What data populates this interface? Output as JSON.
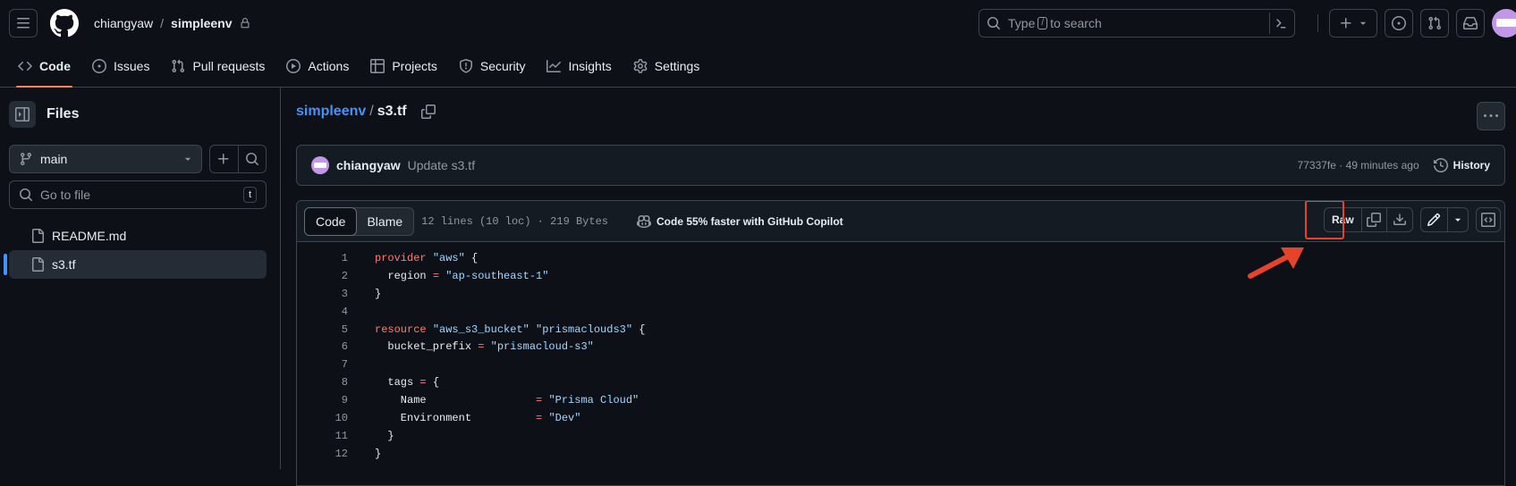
{
  "header": {
    "owner": "chiangyaw",
    "separator": "/",
    "repo": "simpleenv",
    "search_prefix": "Type",
    "search_key": "/",
    "search_suffix": "to search",
    "plus_label": "+"
  },
  "nav": {
    "tabs": [
      {
        "label": "Code",
        "icon": "code-icon"
      },
      {
        "label": "Issues",
        "icon": "issue-icon"
      },
      {
        "label": "Pull requests",
        "icon": "pull-request-icon"
      },
      {
        "label": "Actions",
        "icon": "play-icon"
      },
      {
        "label": "Projects",
        "icon": "table-icon"
      },
      {
        "label": "Security",
        "icon": "shield-icon"
      },
      {
        "label": "Insights",
        "icon": "graph-icon"
      },
      {
        "label": "Settings",
        "icon": "gear-icon"
      }
    ]
  },
  "sidebar": {
    "title": "Files",
    "branch": "main",
    "goto_placeholder": "Go to file",
    "goto_key": "t",
    "files": [
      {
        "name": "README.md",
        "selected": false
      },
      {
        "name": "s3.tf",
        "selected": true
      }
    ]
  },
  "file": {
    "repo_link": "simpleenv",
    "separator": "/",
    "name": "s3.tf"
  },
  "commit": {
    "author": "chiangyaw",
    "message": "Update s3.tf",
    "meta": "77337fe · 49 minutes ago",
    "history_label": "History"
  },
  "code": {
    "tab_code": "Code",
    "tab_blame": "Blame",
    "line_info": "12 lines (10 loc) · 219 Bytes",
    "copilot": "Code 55% faster with GitHub Copilot",
    "raw_label": "Raw",
    "lines": [
      {
        "n": "1",
        "parts": [
          [
            "kw",
            "provider"
          ],
          [
            "ident",
            " "
          ],
          [
            "str",
            "\"aws\""
          ],
          [
            "ident",
            " {"
          ]
        ]
      },
      {
        "n": "2",
        "parts": [
          [
            "ident",
            "  region "
          ],
          [
            "op",
            "="
          ],
          [
            "ident",
            " "
          ],
          [
            "str",
            "\"ap-southeast-1\""
          ]
        ]
      },
      {
        "n": "3",
        "parts": [
          [
            "ident",
            "}"
          ]
        ]
      },
      {
        "n": "4",
        "parts": [
          [
            "ident",
            ""
          ]
        ]
      },
      {
        "n": "5",
        "parts": [
          [
            "kw",
            "resource"
          ],
          [
            "ident",
            " "
          ],
          [
            "str",
            "\"aws_s3_bucket\""
          ],
          [
            "ident",
            " "
          ],
          [
            "str",
            "\"prismaclouds3\""
          ],
          [
            "ident",
            " {"
          ]
        ]
      },
      {
        "n": "6",
        "parts": [
          [
            "ident",
            "  bucket_prefix "
          ],
          [
            "op",
            "="
          ],
          [
            "ident",
            " "
          ],
          [
            "str",
            "\"prismacloud-s3\""
          ]
        ]
      },
      {
        "n": "7",
        "parts": [
          [
            "ident",
            ""
          ]
        ]
      },
      {
        "n": "8",
        "parts": [
          [
            "ident",
            "  tags "
          ],
          [
            "op",
            "="
          ],
          [
            "ident",
            " {"
          ]
        ]
      },
      {
        "n": "9",
        "parts": [
          [
            "ident",
            "    Name                 "
          ],
          [
            "op",
            "="
          ],
          [
            "ident",
            " "
          ],
          [
            "str",
            "\"Prisma Cloud\""
          ]
        ]
      },
      {
        "n": "10",
        "parts": [
          [
            "ident",
            "    Environment          "
          ],
          [
            "op",
            "="
          ],
          [
            "ident",
            " "
          ],
          [
            "str",
            "\"Dev\""
          ]
        ]
      },
      {
        "n": "11",
        "parts": [
          [
            "ident",
            "  }"
          ]
        ]
      },
      {
        "n": "12",
        "parts": [
          [
            "ident",
            "}"
          ]
        ]
      }
    ]
  },
  "colors": {
    "accent_tab": "#f78166",
    "link": "#4493f8",
    "annotation": "#e5432a"
  }
}
